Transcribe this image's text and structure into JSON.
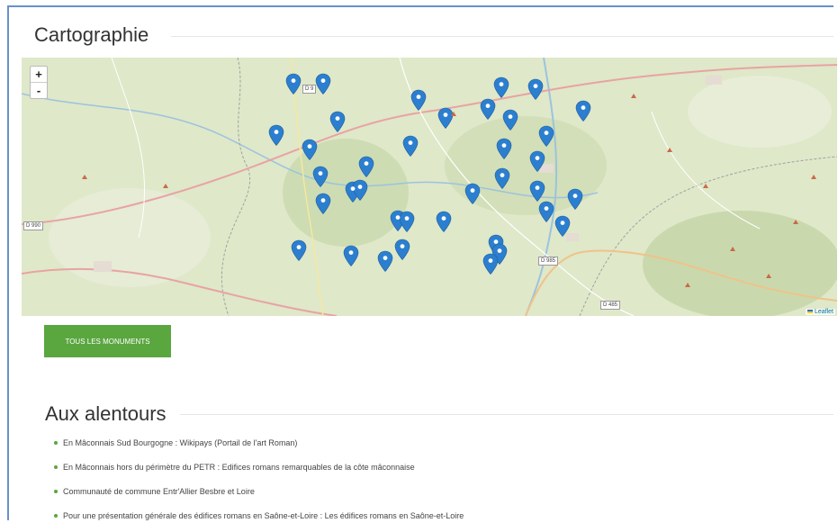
{
  "section_map": {
    "title": "Cartographie"
  },
  "map": {
    "zoom_in": "+",
    "zoom_out": "-",
    "attribution": "Leaflet",
    "road_labels": [
      "D 9",
      "D 990",
      "D 985",
      "D 485"
    ],
    "marker_color": "#2c7fcf",
    "marker_count": 42
  },
  "button": {
    "label": "Tous les monuments",
    "color": "#5aa63f"
  },
  "section_around": {
    "title": "Aux alentours"
  },
  "links": [
    "En Mâconnais Sud Bourgogne : Wikipays (Portail de l'art Roman)",
    "En Mâconnais hors du périmètre du PETR : Edifices romans remarquables de la côte mâconnaise",
    "Communauté de commune Entr'Allier Besbre et Loire",
    "Pour une présentation générale des édifices romans en Saône-et-Loire : Les édifices romans en Saône-et-Loire"
  ]
}
